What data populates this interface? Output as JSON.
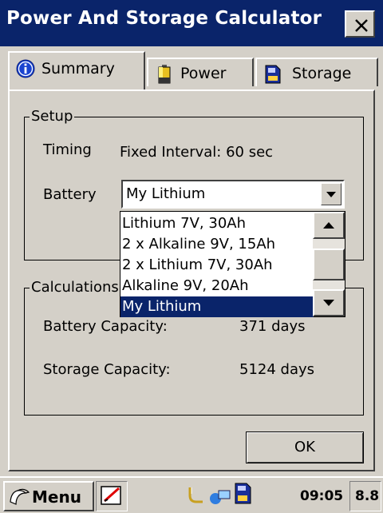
{
  "window": {
    "title": "Power And Storage Calculator",
    "close_label": "×"
  },
  "tabs": [
    {
      "label": "Summary",
      "icon": "info-icon",
      "active": true
    },
    {
      "label": "Power",
      "icon": "battery-icon",
      "active": false
    },
    {
      "label": "Storage",
      "icon": "storage-card-icon",
      "active": false
    }
  ],
  "setup": {
    "legend": "Setup",
    "timing_label": "Timing",
    "timing_value": "Fixed Interval: 60 sec",
    "battery_label": "Battery",
    "battery_selected": "My Lithium",
    "battery_options": [
      "Lithium 7V, 30Ah",
      "2 x Alkaline 9V, 15Ah",
      "2 x Lithium 7V, 30Ah",
      "Alkaline 9V, 20Ah",
      "My Lithium"
    ]
  },
  "calculations": {
    "legend": "Calculations",
    "battery_capacity_label": "Battery Capacity:",
    "battery_capacity_value": "371 days",
    "storage_capacity_label": "Storage Capacity:",
    "storage_capacity_value": "5124 days"
  },
  "ok_label": "OK",
  "taskbar": {
    "menu_label": "Menu",
    "time": "09:05",
    "version": "8.8"
  },
  "colors": {
    "titlebar": "#0a246a",
    "selection": "#0a246a",
    "face": "#d4d0c8"
  }
}
